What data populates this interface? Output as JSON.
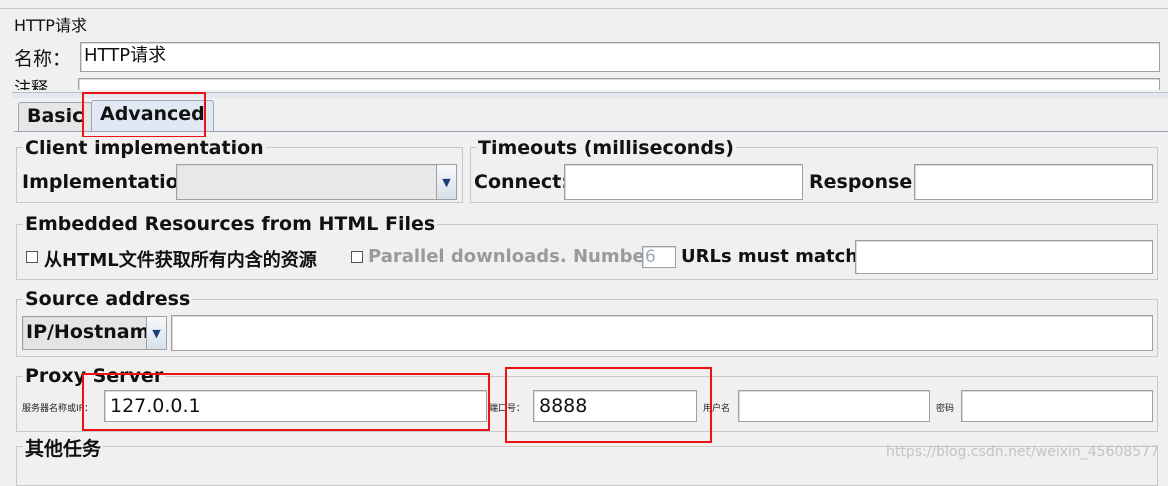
{
  "header": {
    "title": "HTTP请求",
    "name_label": "名称：",
    "name_value": "HTTP请求",
    "comment_label": "注释"
  },
  "tabs": [
    {
      "label": "Basic"
    },
    {
      "label": "Advanced"
    }
  ],
  "client_impl": {
    "legend": "Client implementation",
    "impl_label": "Implementation:",
    "impl_value": ""
  },
  "timeouts": {
    "legend": "Timeouts (milliseconds)",
    "connect_label": "Connect:",
    "connect_value": "",
    "response_label": "Response:",
    "response_value": ""
  },
  "embedded": {
    "legend": "Embedded Resources from HTML Files",
    "retrieve_label": "从HTML文件获取所有内含的资源",
    "parallel_label": "Parallel downloads. Number:",
    "parallel_value": "6",
    "urls_label": "URLs must match:",
    "urls_value": ""
  },
  "source": {
    "legend": "Source address",
    "type_value": "IP/Hostname",
    "address_value": ""
  },
  "proxy": {
    "legend": "Proxy Server",
    "server_label": "服务器名称或IP：",
    "server_value": "127.0.0.1",
    "port_label": "端口号：",
    "port_value": "8888",
    "user_label": "用户名",
    "user_value": "",
    "password_label": "密码",
    "password_value": ""
  },
  "other": {
    "legend": "其他任务"
  },
  "watermark": "https://blog.csdn.net/weixin_45608577",
  "colors": {
    "highlight": "#ee1111",
    "background": "#f0f0f0",
    "tab_active": "#dfe8f3"
  }
}
